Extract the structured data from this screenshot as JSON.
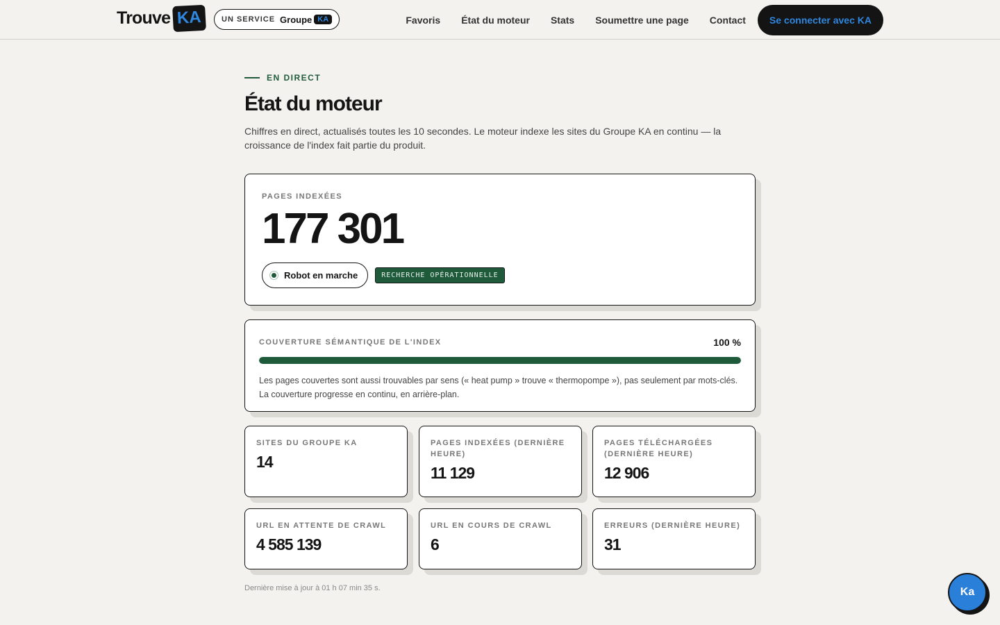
{
  "header": {
    "logo_text": "Trouve",
    "logo_badge": "KA",
    "service_label": "UN SERVICE",
    "service_brand": "Groupe",
    "service_badge": "KA",
    "nav": [
      "Favoris",
      "État du moteur",
      "Stats",
      "Soumettre une page",
      "Contact"
    ],
    "login_label": "Se connecter avec KA"
  },
  "page": {
    "eyebrow": "EN DIRECT",
    "title": "État du moteur",
    "description": "Chiffres en direct, actualisés toutes les 10 secondes. Le moteur indexe les sites du Groupe KA en continu — la croissance de l'index fait partie du produit."
  },
  "hero": {
    "label": "PAGES INDEXÉES",
    "value": "177 301",
    "robot_status": "Robot en marche",
    "search_status": "RECHERCHE OPÉRATIONNELLE"
  },
  "coverage": {
    "label": "COUVERTURE SÉMANTIQUE DE L'INDEX",
    "value_text": "100 %",
    "fraction": 1.0,
    "note": "Les pages couvertes sont aussi trouvables par sens (« heat pump » trouve « thermopompe »), pas seulement par mots-clés. La couverture progresse en continu, en arrière-plan."
  },
  "stats": [
    {
      "label": "SITES DU GROUPE KA",
      "value": "14"
    },
    {
      "label": "PAGES INDEXÉES (DERNIÈRE HEURE)",
      "value": "11 129"
    },
    {
      "label": "PAGES TÉLÉCHARGÉES (DERNIÈRE HEURE)",
      "value": "12 906"
    },
    {
      "label": "URL EN ATTENTE DE CRAWL",
      "value": "4 585 139"
    },
    {
      "label": "URL EN COURS DE CRAWL",
      "value": "6"
    },
    {
      "label": "ERREURS (DERNIÈRE HEURE)",
      "value": "31"
    }
  ],
  "updated": "Dernière mise à jour à 01 h 07 min 35 s.",
  "fab_label": "Ka",
  "colors": {
    "accent_green": "#1f5a3b",
    "brand_blue": "#2f87e0",
    "background": "#f3f2ee"
  }
}
